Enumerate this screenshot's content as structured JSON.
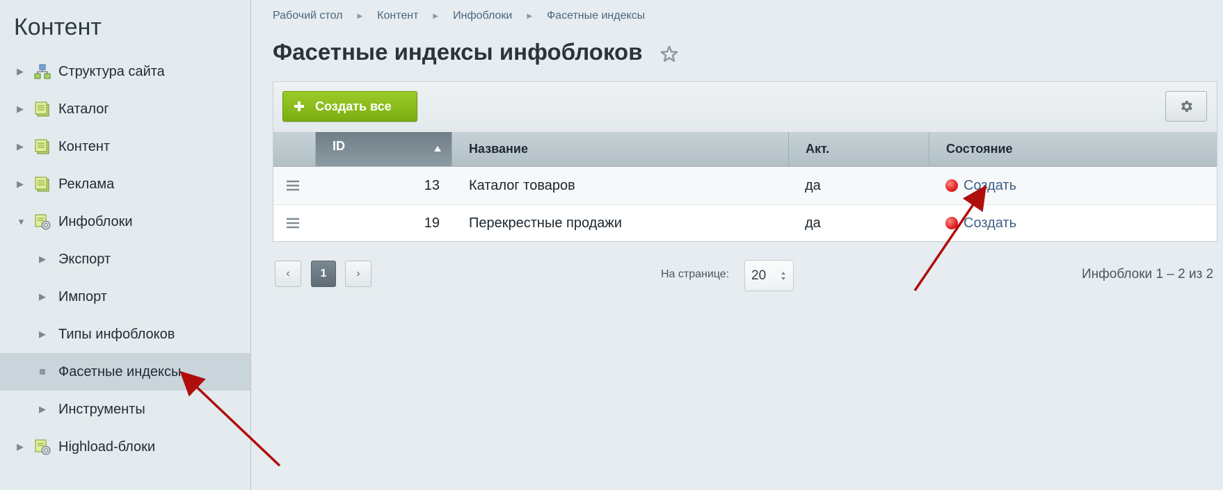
{
  "sidebar": {
    "title": "Контент",
    "items": [
      {
        "label": "Структура сайта"
      },
      {
        "label": "Каталог"
      },
      {
        "label": "Контент"
      },
      {
        "label": "Реклама"
      },
      {
        "label": "Инфоблоки"
      },
      {
        "label": "Экспорт"
      },
      {
        "label": "Импорт"
      },
      {
        "label": "Типы инфоблоков"
      },
      {
        "label": "Фасетные индексы"
      },
      {
        "label": "Инструменты"
      },
      {
        "label": "Highload-блоки"
      }
    ]
  },
  "breadcrumb": [
    "Рабочий стол",
    "Контент",
    "Инфоблоки",
    "Фасетные индексы"
  ],
  "page": {
    "title": "Фасетные индексы инфоблоков"
  },
  "toolbar": {
    "create_all_label": "Создать все"
  },
  "table": {
    "columns": {
      "id": "ID",
      "name": "Название",
      "active": "Акт.",
      "status": "Состояние"
    },
    "rows": [
      {
        "id": "13",
        "name": "Каталог товаров",
        "active": "да",
        "status": "Создать"
      },
      {
        "id": "19",
        "name": "Перекрестные продажи",
        "active": "да",
        "status": "Создать"
      }
    ]
  },
  "pager": {
    "current_page": "1",
    "per_page_label": "На странице:",
    "per_page_value": "20",
    "total_text": "Инфоблоки 1 – 2 из 2"
  },
  "colors": {
    "accent_green": "#7aae10",
    "status_red": "#e02121",
    "annotation_arrow": "#b00d0d"
  }
}
